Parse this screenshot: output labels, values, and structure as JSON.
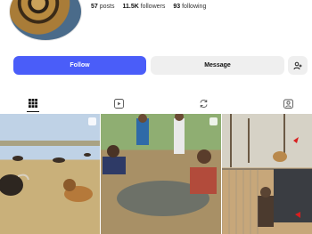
{
  "profile": {
    "posts_count": "57",
    "posts_label": "posts",
    "followers_count": "11.5K",
    "followers_label": "followers",
    "following_count": "93",
    "following_label": "following"
  },
  "actions": {
    "follow_label": "Follow",
    "message_label": "Message"
  },
  "colors": {
    "follow_button": "#4a5df9",
    "secondary_button": "#efefef"
  },
  "tabs": [
    {
      "icon": "grid-icon",
      "active": true
    },
    {
      "icon": "reels-icon",
      "active": false
    },
    {
      "icon": "reposts-icon",
      "active": false
    },
    {
      "icon": "tagged-icon",
      "active": false
    }
  ],
  "posts": [
    {
      "type": "image",
      "icon": "carousel-icon"
    },
    {
      "type": "reel",
      "icon": "reel-icon"
    },
    {
      "type": "image",
      "icon": "none"
    }
  ]
}
